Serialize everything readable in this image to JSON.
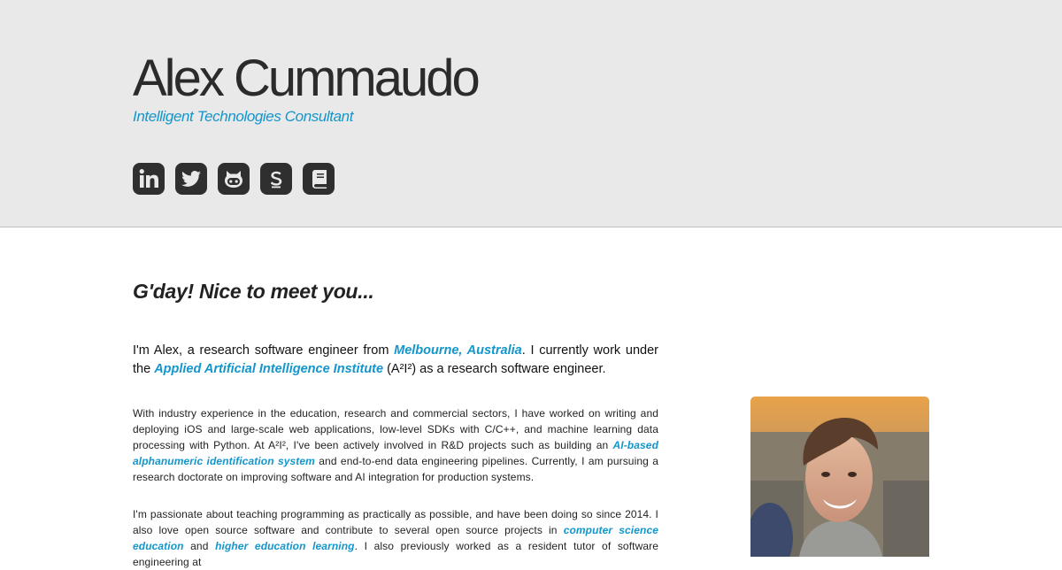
{
  "header": {
    "name": "Alex Cummaudo",
    "tagline": "Intelligent Technologies Consultant",
    "social_links": [
      {
        "icon": "linkedin-icon"
      },
      {
        "icon": "twitter-icon"
      },
      {
        "icon": "github-icon"
      },
      {
        "icon": "stackoverflow-icon"
      },
      {
        "icon": "book-icon"
      }
    ]
  },
  "main": {
    "heading": "G'day! Nice to meet you...",
    "lead": {
      "t1": "I'm Alex, a research software engineer from ",
      "link1": "Melbourne, Australia",
      "t2": ". I currently work under the ",
      "link2": "Applied Artificial Intelligence Institute",
      "t3": " (A²I²) as a research software engineer."
    },
    "para1": {
      "t1": "With industry experience in the education, research and commercial sectors, I have worked on writing and deploying iOS and large-scale web applications, low-level SDKs with C/C++, and machine learning data processing with Python. At A²I², I've been actively involved in R&D projects such as building an ",
      "link1": "AI-based alphanumeric identification system",
      "t2": " and end-to-end data engineering pipelines. Currently, I am pursuing a research doctorate on improving software and AI integration for production systems."
    },
    "para2": {
      "t1": "I'm passionate about teaching programming as practically as possible, and have been doing so since 2014. I also love open source software and contribute to several open source projects in ",
      "link1": "computer science education",
      "t2": " and ",
      "link2": "higher education learning",
      "t3": ". I also previously worked as a resident tutor of software engineering at"
    }
  },
  "colors": {
    "header_bg": "#e9e9e9",
    "accent": "#1296cc",
    "icon_bg": "#2f2f2f"
  }
}
